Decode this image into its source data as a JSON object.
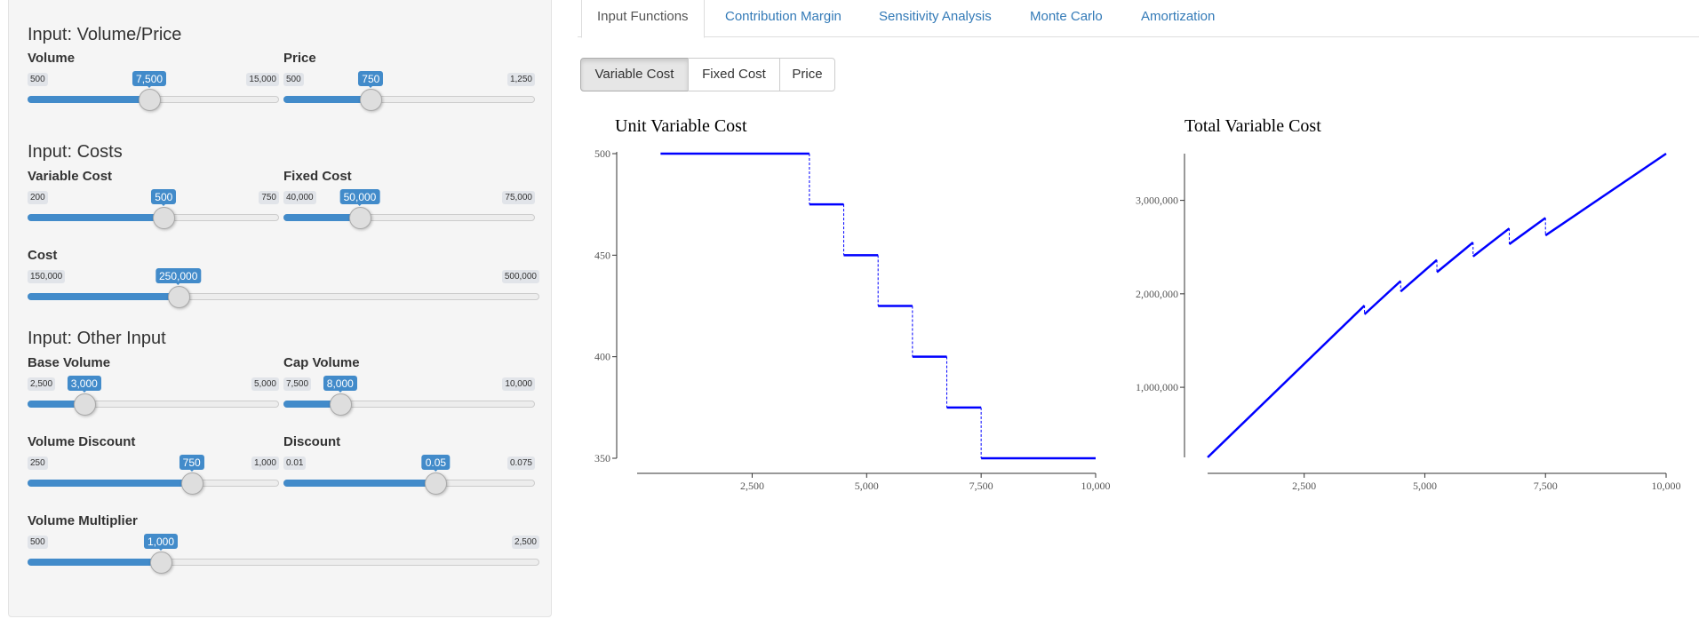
{
  "sidebar": {
    "sections": {
      "volume_price": "Input: Volume/Price",
      "costs": "Input: Costs",
      "other": "Input: Other Input"
    },
    "sliders": {
      "volume": {
        "label": "Volume",
        "min": "500",
        "max": "15,000",
        "value": "7,500",
        "fraction": 0.4828
      },
      "price": {
        "label": "Price",
        "min": "500",
        "max": "1,250",
        "value": "750",
        "fraction": 0.3333
      },
      "variable_cost": {
        "label": "Variable Cost",
        "min": "200",
        "max": "750",
        "value": "500",
        "fraction": 0.5455
      },
      "fixed_cost": {
        "label": "Fixed Cost",
        "min": "40,000",
        "max": "75,000",
        "value": "50,000",
        "fraction": 0.2857
      },
      "cost": {
        "label": "Cost",
        "min": "150,000",
        "max": "500,000",
        "value": "250,000",
        "fraction": 0.2857
      },
      "base_volume": {
        "label": "Base Volume",
        "min": "2,500",
        "max": "5,000",
        "value": "3,000",
        "fraction": 0.2
      },
      "cap_volume": {
        "label": "Cap Volume",
        "min": "7,500",
        "max": "10,000",
        "value": "8,000",
        "fraction": 0.2
      },
      "volume_discount": {
        "label": "Volume Discount",
        "min": "250",
        "max": "1,000",
        "value": "750",
        "fraction": 0.6667
      },
      "discount": {
        "label": "Discount",
        "min": "0.01",
        "max": "0.075",
        "value": "0.05",
        "fraction": 0.6154
      },
      "volume_multiplier": {
        "label": "Volume Multiplier",
        "min": "500",
        "max": "2,500",
        "value": "1,000",
        "fraction": 0.25
      }
    }
  },
  "tabs": [
    {
      "label": "Input Functions",
      "active": true
    },
    {
      "label": "Contribution Margin",
      "active": false
    },
    {
      "label": "Sensitivity Analysis",
      "active": false
    },
    {
      "label": "Monte Carlo",
      "active": false
    },
    {
      "label": "Amortization",
      "active": false
    }
  ],
  "buttons": [
    {
      "label": "Variable Cost",
      "active": true
    },
    {
      "label": "Fixed Cost",
      "active": false
    },
    {
      "label": "Price",
      "active": false
    }
  ],
  "colors": {
    "accent": "#428bca",
    "line": "#0000ff"
  },
  "chart_data": [
    {
      "type": "line",
      "title": "Unit Variable Cost",
      "xlabel": "",
      "ylabel": "",
      "xlim": [
        0,
        10000
      ],
      "ylim": [
        350,
        500
      ],
      "x_ticks": [
        "2,500",
        "5,000",
        "7,500",
        "10,000"
      ],
      "y_ticks": [
        "350",
        "400",
        "450",
        "500"
      ],
      "style": "step",
      "steps": [
        {
          "x0": 500,
          "x1": 3750,
          "y": 500
        },
        {
          "x0": 3750,
          "x1": 4500,
          "y": 475
        },
        {
          "x0": 4500,
          "x1": 5250,
          "y": 450
        },
        {
          "x0": 5250,
          "x1": 6000,
          "y": 425
        },
        {
          "x0": 6000,
          "x1": 6750,
          "y": 400
        },
        {
          "x0": 6750,
          "x1": 7500,
          "y": 375
        },
        {
          "x0": 7500,
          "x1": 10000,
          "y": 350
        }
      ]
    },
    {
      "type": "line",
      "title": "Total Variable Cost",
      "xlabel": "",
      "ylabel": "",
      "xlim": [
        0,
        10000
      ],
      "ylim": [
        250000,
        3500000
      ],
      "x_ticks": [
        "2,500",
        "5,000",
        "7,500",
        "10,000"
      ],
      "y_ticks": [
        "1,000,000",
        "2,000,000",
        "3,000,000"
      ],
      "segments": [
        {
          "x": [
            500,
            3750
          ],
          "y": [
            250000,
            1875000
          ]
        },
        {
          "x": [
            3750,
            4500
          ],
          "y": [
            1781250,
            2137500
          ]
        },
        {
          "x": [
            4500,
            5250
          ],
          "y": [
            2025000,
            2362500
          ]
        },
        {
          "x": [
            5250,
            6000
          ],
          "y": [
            2231250,
            2550000
          ]
        },
        {
          "x": [
            6000,
            6750
          ],
          "y": [
            2400000,
            2700000
          ]
        },
        {
          "x": [
            6750,
            7500
          ],
          "y": [
            2531250,
            2812500
          ]
        },
        {
          "x": [
            7500,
            10000
          ],
          "y": [
            2625000,
            3500000
          ]
        }
      ]
    }
  ]
}
